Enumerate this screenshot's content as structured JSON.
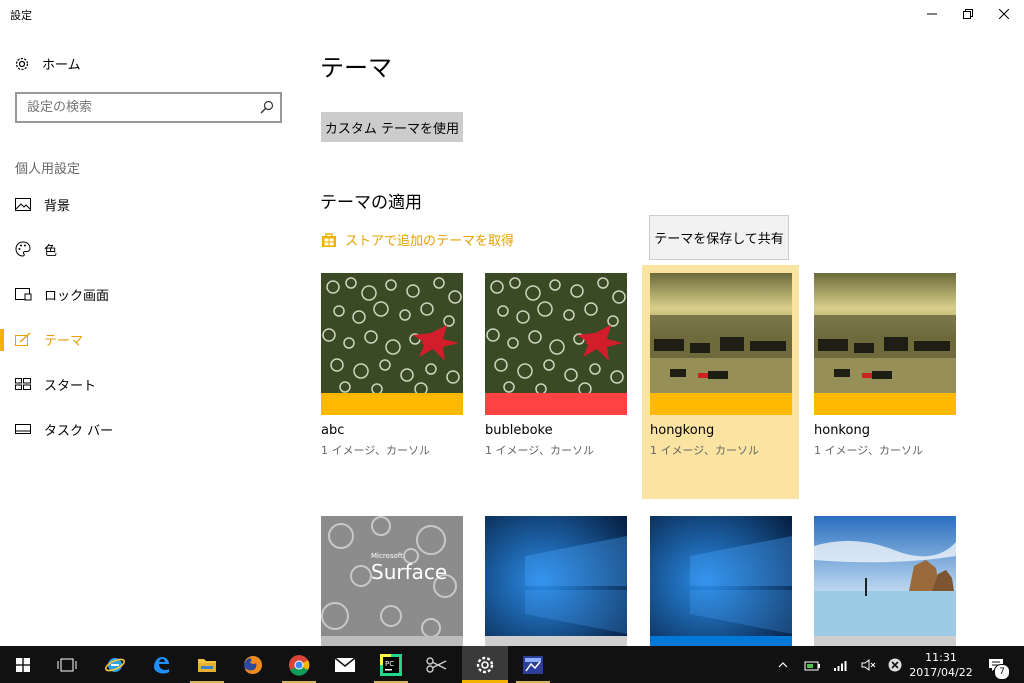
{
  "window": {
    "title": "設定"
  },
  "sidebar": {
    "home_label": "ホーム",
    "search_placeholder": "設定の検索",
    "section_label": "個人用設定",
    "items": [
      {
        "label": "背景",
        "icon": "picture-icon"
      },
      {
        "label": "色",
        "icon": "palette-icon"
      },
      {
        "label": "ロック画面",
        "icon": "lock-screen-icon"
      },
      {
        "label": "テーマ",
        "icon": "theme-brush-icon",
        "active": true
      },
      {
        "label": "スタート",
        "icon": "start-tiles-icon"
      },
      {
        "label": "タスク バー",
        "icon": "taskbar-icon"
      }
    ]
  },
  "main": {
    "title": "テーマ",
    "custom_theme_button": "カスタム テーマを使用",
    "apply_heading": "テーマの適用",
    "store_link": "ストアで追加のテーマを取得",
    "tooltip": "テーマを保存して共有",
    "themes": [
      {
        "name": "abc",
        "sub": "1 イメージ、カーソル",
        "color": "#ffb900",
        "image": "bokeh-leaves"
      },
      {
        "name": "bubleboke",
        "sub": "1 イメージ、カーソル",
        "color": "#ff4343",
        "image": "bokeh-leaves"
      },
      {
        "name": "hongkong",
        "sub": "1 イメージ、カーソル",
        "color": "#ffb900",
        "image": "harbor",
        "selected": true
      },
      {
        "name": "honkong",
        "sub": "1 イメージ、カーソル",
        "color": "#ffb900",
        "image": "harbor"
      }
    ],
    "themes_row2": [
      {
        "image": "surface",
        "brand_text": "Surface",
        "brand_small": "Microsoft"
      },
      {
        "image": "windows-blue"
      },
      {
        "image": "windows-blue"
      },
      {
        "image": "beach"
      }
    ]
  },
  "taskbar": {
    "clock_time": "11:31",
    "clock_date": "2017/04/22",
    "notification_count": "7"
  },
  "colors": {
    "accent": "#f2b000",
    "accent_text": "#e6a100",
    "selected_bg": "#fbe4a1"
  }
}
